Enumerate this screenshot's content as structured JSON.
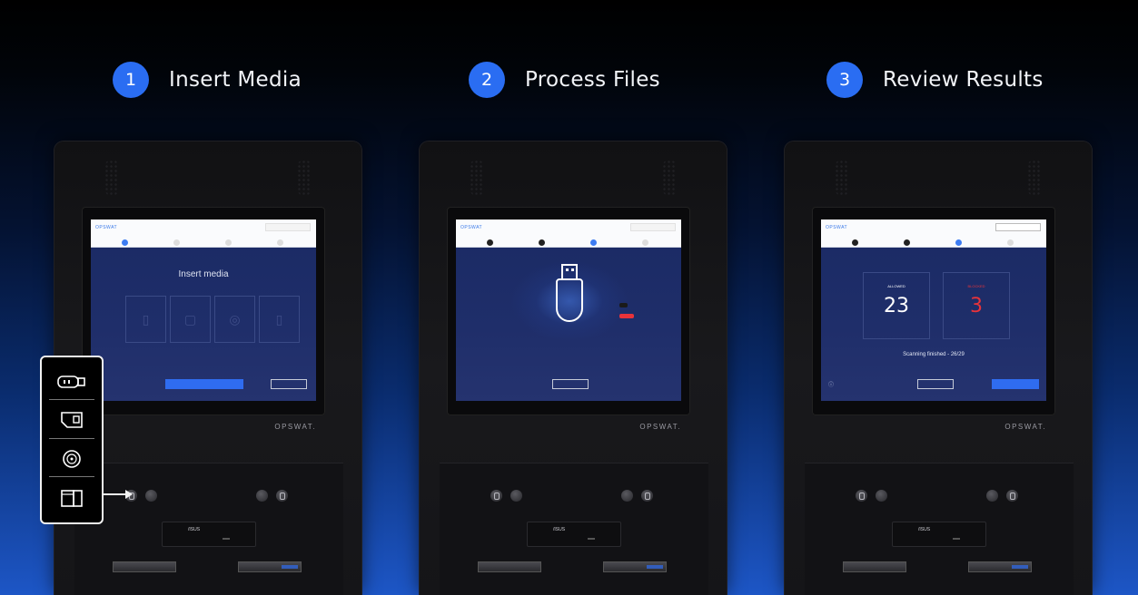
{
  "steps": [
    {
      "num": "1",
      "title": "Insert Media"
    },
    {
      "num": "2",
      "title": "Process Files"
    },
    {
      "num": "3",
      "title": "Review Results"
    }
  ],
  "brand": "OPSWAT.",
  "kiosk_screen": {
    "logo": "OPSWAT",
    "insert_title": "Insert media",
    "results": {
      "allowed_label": "ALLOWED",
      "allowed_value": "23",
      "blocked_label": "BLOCKED",
      "blocked_value": "3",
      "scan_finished": "Scanning finished - 26/29"
    }
  },
  "drive_brand": "/ISUS",
  "colors": {
    "accent": "#2a6df2",
    "blocked": "#e8333a",
    "screen_bg": "#1f2e6a"
  },
  "icons": [
    "usb-icon",
    "sd-card-icon",
    "disc-icon",
    "device-icon",
    "help-icon"
  ]
}
